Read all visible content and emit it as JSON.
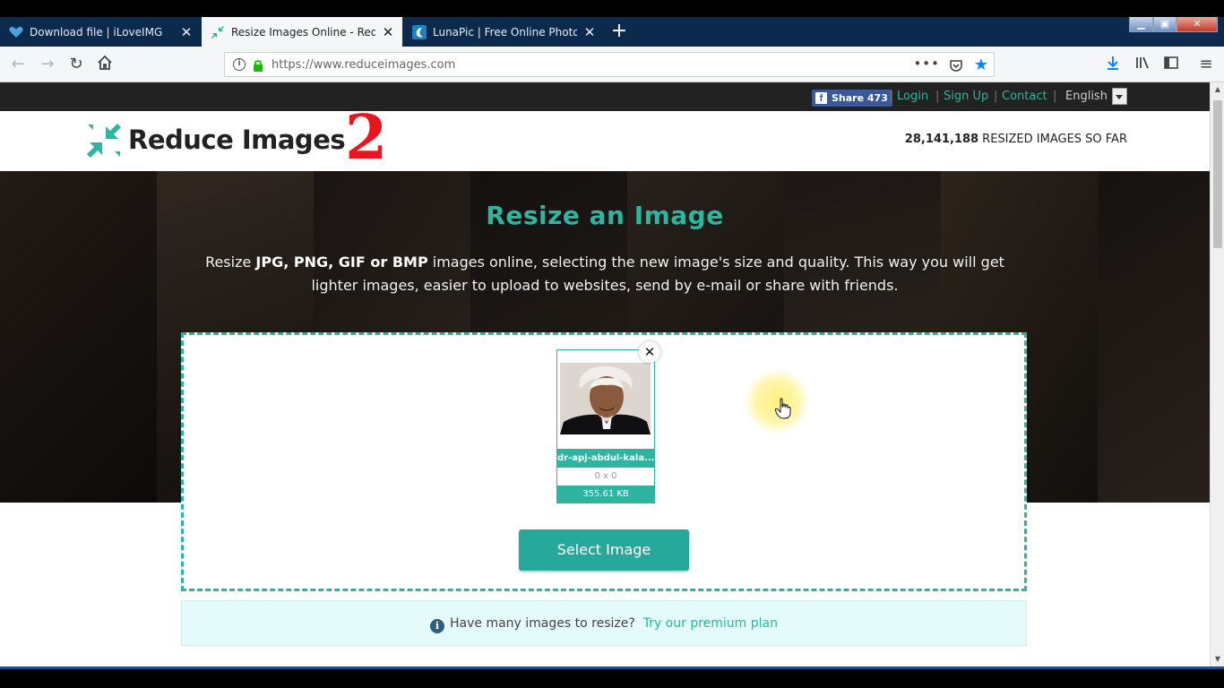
{
  "browser": {
    "tabs": [
      {
        "title": "Download file | iLoveIMG",
        "active": false
      },
      {
        "title": "Resize Images Online - Reduce",
        "active": true
      },
      {
        "title": "LunaPic | Free Online Photo Ed",
        "active": false
      }
    ],
    "new_tab_label": "+",
    "url": "https://www.reduceimages.com",
    "menu_dots": "•••"
  },
  "topbar": {
    "share_label": "Share",
    "share_count": "473",
    "login": "Login",
    "signup": "Sign Up",
    "contact": "Contact",
    "separator": "|",
    "language": "English"
  },
  "header": {
    "logo_text": "Reduce Images",
    "annotation_number": "2",
    "counter_value": "28,141,188",
    "counter_label": " RESIZED IMAGES SO FAR"
  },
  "hero": {
    "title": "Resize an Image",
    "desc_prefix": "Resize ",
    "desc_formats": "JPG, PNG, GIF or BMP",
    "desc_suffix": " images online, selecting the new image's size and quality. This way you will get lighter images, easier to upload to websites, send by e-mail or share with friends."
  },
  "upload": {
    "file_name": "dr-apj-abdul-kala...",
    "dimensions": "0 x 0",
    "file_size": "355.61 KB",
    "remove_label": "✕",
    "select_button": "Select Image"
  },
  "notice": {
    "text": "Have many images to resize?",
    "link": "Try our premium plan"
  },
  "colors": {
    "accent": "#2db5a0",
    "button": "#26a99a",
    "tabbar": "#0b2a4e",
    "facebook": "#3b5998",
    "annotation": "#e8141f"
  },
  "icons": {
    "back": "arrow-left-icon",
    "forward": "arrow-right-icon",
    "reload": "reload-icon",
    "home": "home-icon",
    "info": "info-icon",
    "lock": "lock-icon",
    "pocket": "pocket-icon",
    "bookmark": "star-icon",
    "download": "download-icon",
    "library": "library-icon",
    "sidebar": "sidebar-icon",
    "menu": "hamburger-icon"
  }
}
